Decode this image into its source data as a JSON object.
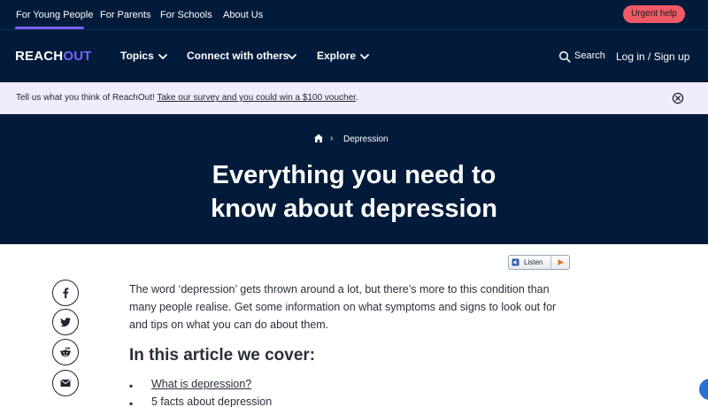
{
  "topbar": {
    "audiences": [
      {
        "label": "For Young People",
        "active": true
      },
      {
        "label": "For Parents",
        "active": false
      },
      {
        "label": "For Schools",
        "active": false
      },
      {
        "label": "About Us",
        "active": false
      }
    ],
    "urgent_help": "Urgent help"
  },
  "nav": {
    "logo_main": "REACH",
    "logo_accent": "OUT",
    "items": [
      {
        "label": "Topics",
        "icon": "chevron-down-icon"
      },
      {
        "label": "Connect with others",
        "icon": "chevron-down-icon"
      },
      {
        "label": "Explore",
        "icon": "chevron-down-icon"
      }
    ],
    "search_label": "Search",
    "login_label": "Log in / Sign up"
  },
  "banner": {
    "text": "Tell us what you think of ReachOut! ",
    "link": "Take our survey and you could win a $100 voucher",
    "end": ".",
    "close_icon": "close-circle-icon"
  },
  "hero": {
    "breadcrumb_home_icon": "home-icon",
    "breadcrumb_sep": "›",
    "breadcrumb_current": "Depression",
    "title_line1": "Everything you need to",
    "title_line2": "know about depression"
  },
  "listen": {
    "label": "Listen",
    "icon": "speaker-icon",
    "play_icon": "play-icon"
  },
  "share": [
    {
      "name": "facebook-icon"
    },
    {
      "name": "twitter-icon"
    },
    {
      "name": "reddit-icon"
    },
    {
      "name": "email-icon"
    }
  ],
  "article": {
    "intro": "The word ‘depression’ gets thrown around a lot, but there’s more to this condition than many people realise. Get some information on what symptoms and signs to look out for and tips on what you can do about them.",
    "cover_heading": "In this article we cover:",
    "bullet_glyph": "▪",
    "toc": [
      {
        "label": "What is depression?",
        "linked": true
      },
      {
        "label": "5 facts about depression",
        "linked": false
      }
    ]
  },
  "colors": {
    "navy": "#021b3a",
    "purple_accent": "#7b61ff",
    "urgent_red": "#f05a66",
    "banner_lavender": "#f1ecfb"
  }
}
